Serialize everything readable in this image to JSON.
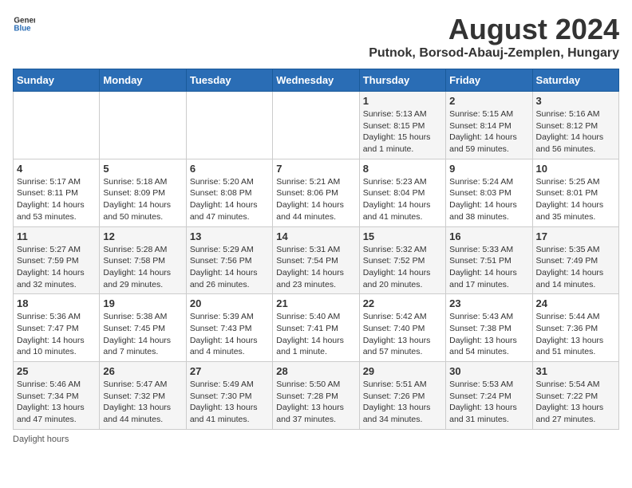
{
  "header": {
    "logo_general": "General",
    "logo_blue": "Blue",
    "title": "August 2024",
    "subtitle": "Putnok, Borsod-Abauj-Zemplen, Hungary"
  },
  "days_of_week": [
    "Sunday",
    "Monday",
    "Tuesday",
    "Wednesday",
    "Thursday",
    "Friday",
    "Saturday"
  ],
  "weeks": [
    [
      {
        "day": "",
        "info": ""
      },
      {
        "day": "",
        "info": ""
      },
      {
        "day": "",
        "info": ""
      },
      {
        "day": "",
        "info": ""
      },
      {
        "day": "1",
        "info": "Sunrise: 5:13 AM\nSunset: 8:15 PM\nDaylight: 15 hours and 1 minute."
      },
      {
        "day": "2",
        "info": "Sunrise: 5:15 AM\nSunset: 8:14 PM\nDaylight: 14 hours and 59 minutes."
      },
      {
        "day": "3",
        "info": "Sunrise: 5:16 AM\nSunset: 8:12 PM\nDaylight: 14 hours and 56 minutes."
      }
    ],
    [
      {
        "day": "4",
        "info": "Sunrise: 5:17 AM\nSunset: 8:11 PM\nDaylight: 14 hours and 53 minutes."
      },
      {
        "day": "5",
        "info": "Sunrise: 5:18 AM\nSunset: 8:09 PM\nDaylight: 14 hours and 50 minutes."
      },
      {
        "day": "6",
        "info": "Sunrise: 5:20 AM\nSunset: 8:08 PM\nDaylight: 14 hours and 47 minutes."
      },
      {
        "day": "7",
        "info": "Sunrise: 5:21 AM\nSunset: 8:06 PM\nDaylight: 14 hours and 44 minutes."
      },
      {
        "day": "8",
        "info": "Sunrise: 5:23 AM\nSunset: 8:04 PM\nDaylight: 14 hours and 41 minutes."
      },
      {
        "day": "9",
        "info": "Sunrise: 5:24 AM\nSunset: 8:03 PM\nDaylight: 14 hours and 38 minutes."
      },
      {
        "day": "10",
        "info": "Sunrise: 5:25 AM\nSunset: 8:01 PM\nDaylight: 14 hours and 35 minutes."
      }
    ],
    [
      {
        "day": "11",
        "info": "Sunrise: 5:27 AM\nSunset: 7:59 PM\nDaylight: 14 hours and 32 minutes."
      },
      {
        "day": "12",
        "info": "Sunrise: 5:28 AM\nSunset: 7:58 PM\nDaylight: 14 hours and 29 minutes."
      },
      {
        "day": "13",
        "info": "Sunrise: 5:29 AM\nSunset: 7:56 PM\nDaylight: 14 hours and 26 minutes."
      },
      {
        "day": "14",
        "info": "Sunrise: 5:31 AM\nSunset: 7:54 PM\nDaylight: 14 hours and 23 minutes."
      },
      {
        "day": "15",
        "info": "Sunrise: 5:32 AM\nSunset: 7:52 PM\nDaylight: 14 hours and 20 minutes."
      },
      {
        "day": "16",
        "info": "Sunrise: 5:33 AM\nSunset: 7:51 PM\nDaylight: 14 hours and 17 minutes."
      },
      {
        "day": "17",
        "info": "Sunrise: 5:35 AM\nSunset: 7:49 PM\nDaylight: 14 hours and 14 minutes."
      }
    ],
    [
      {
        "day": "18",
        "info": "Sunrise: 5:36 AM\nSunset: 7:47 PM\nDaylight: 14 hours and 10 minutes."
      },
      {
        "day": "19",
        "info": "Sunrise: 5:38 AM\nSunset: 7:45 PM\nDaylight: 14 hours and 7 minutes."
      },
      {
        "day": "20",
        "info": "Sunrise: 5:39 AM\nSunset: 7:43 PM\nDaylight: 14 hours and 4 minutes."
      },
      {
        "day": "21",
        "info": "Sunrise: 5:40 AM\nSunset: 7:41 PM\nDaylight: 14 hours and 1 minute."
      },
      {
        "day": "22",
        "info": "Sunrise: 5:42 AM\nSunset: 7:40 PM\nDaylight: 13 hours and 57 minutes."
      },
      {
        "day": "23",
        "info": "Sunrise: 5:43 AM\nSunset: 7:38 PM\nDaylight: 13 hours and 54 minutes."
      },
      {
        "day": "24",
        "info": "Sunrise: 5:44 AM\nSunset: 7:36 PM\nDaylight: 13 hours and 51 minutes."
      }
    ],
    [
      {
        "day": "25",
        "info": "Sunrise: 5:46 AM\nSunset: 7:34 PM\nDaylight: 13 hours and 47 minutes."
      },
      {
        "day": "26",
        "info": "Sunrise: 5:47 AM\nSunset: 7:32 PM\nDaylight: 13 hours and 44 minutes."
      },
      {
        "day": "27",
        "info": "Sunrise: 5:49 AM\nSunset: 7:30 PM\nDaylight: 13 hours and 41 minutes."
      },
      {
        "day": "28",
        "info": "Sunrise: 5:50 AM\nSunset: 7:28 PM\nDaylight: 13 hours and 37 minutes."
      },
      {
        "day": "29",
        "info": "Sunrise: 5:51 AM\nSunset: 7:26 PM\nDaylight: 13 hours and 34 minutes."
      },
      {
        "day": "30",
        "info": "Sunrise: 5:53 AM\nSunset: 7:24 PM\nDaylight: 13 hours and 31 minutes."
      },
      {
        "day": "31",
        "info": "Sunrise: 5:54 AM\nSunset: 7:22 PM\nDaylight: 13 hours and 27 minutes."
      }
    ]
  ],
  "footer": {
    "note": "Daylight hours"
  }
}
